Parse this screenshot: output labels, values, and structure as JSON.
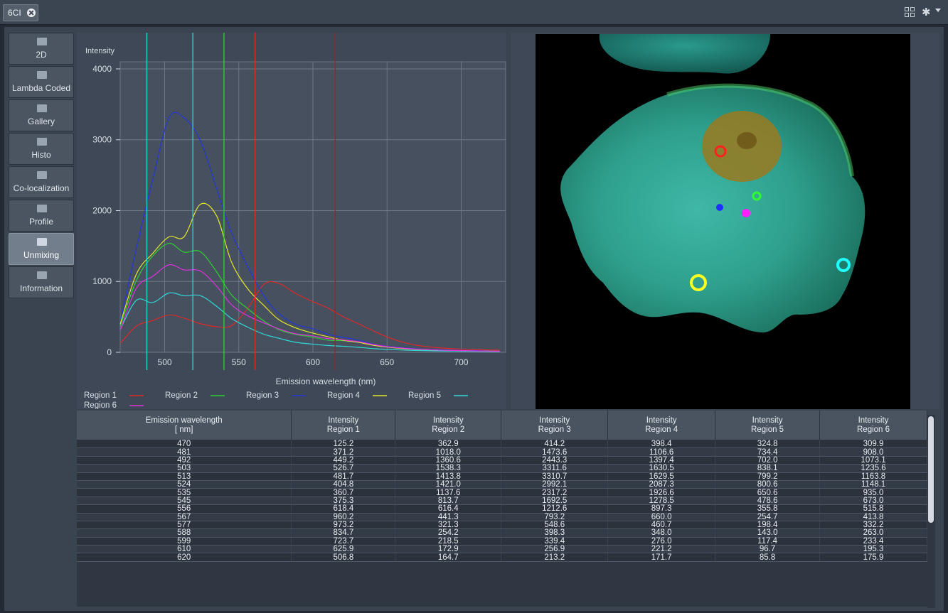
{
  "window": {
    "tab_label": "6CI"
  },
  "view_tabs": [
    {
      "label": "2D",
      "icon": "monitor-icon"
    },
    {
      "label": "Lambda Coded",
      "icon": "lambda-icon"
    },
    {
      "label": "Gallery",
      "icon": "gallery-grid-icon"
    },
    {
      "label": "Histo",
      "icon": "histogram-icon"
    },
    {
      "label": "Co-localization",
      "icon": "colocalization-icon"
    },
    {
      "label": "Profile",
      "icon": "profile-icon"
    },
    {
      "label": "Unmixing",
      "icon": "unmixing-icon",
      "active": true
    },
    {
      "label": "Information",
      "icon": "info-icon"
    }
  ],
  "chart_data": {
    "type": "line",
    "ylabel": "Intensity",
    "xlabel": "Emission wavelength (nm)",
    "xlim": [
      470,
      730
    ],
    "ylim": [
      0,
      4100
    ],
    "xticks": [
      500,
      550,
      600,
      650,
      700
    ],
    "yticks": [
      0,
      1000,
      2000,
      3000,
      4000
    ],
    "grid": true,
    "legend_position": "bottom",
    "x": [
      470,
      481,
      492,
      503,
      513,
      524,
      535,
      545,
      556,
      567,
      577,
      588,
      599,
      610,
      620,
      631,
      642,
      652,
      663,
      673,
      684,
      695,
      705,
      716,
      726
    ],
    "series": [
      {
        "name": "Region 1",
        "color": "#e02828",
        "values": [
          125.2,
          371.2,
          449.2,
          526.7,
          481.7,
          404.8,
          360.7,
          375.3,
          618.4,
          960.2,
          973.2,
          834.7,
          723.7,
          625.9,
          506.8,
          400,
          290,
          200,
          130,
          90,
          65,
          50,
          40,
          35,
          30
        ]
      },
      {
        "name": "Region 2",
        "color": "#2fd12f",
        "values": [
          362.9,
          1018.0,
          1360.6,
          1538.3,
          1413.8,
          1421.0,
          1137.6,
          813.7,
          616.4,
          441.3,
          321.3,
          254.2,
          218.5,
          172.9,
          164.7,
          140,
          100,
          70,
          50,
          40,
          30,
          25,
          20,
          18,
          15
        ]
      },
      {
        "name": "Region 3",
        "color": "#2436d6",
        "values": [
          414.2,
          1473.6,
          2443.3,
          3311.6,
          3310.7,
          2992.1,
          2317.2,
          1692.5,
          1212.6,
          793.2,
          548.6,
          398.3,
          339.4,
          256.9,
          213.2,
          170,
          110,
          80,
          60,
          45,
          35,
          30,
          25,
          20,
          18
        ]
      },
      {
        "name": "Region 4",
        "color": "#e6e62a",
        "values": [
          398.4,
          1106.6,
          1397.4,
          1630.5,
          1629.5,
          2087.3,
          1926.6,
          1278.5,
          897.3,
          660.0,
          460.7,
          348.0,
          276.0,
          221.2,
          171.7,
          140,
          95,
          70,
          50,
          40,
          30,
          25,
          20,
          18,
          15
        ]
      },
      {
        "name": "Region 5",
        "color": "#2fd8d8",
        "values": [
          324.8,
          734.4,
          702.0,
          838.1,
          799.2,
          800.6,
          650.6,
          478.6,
          355.8,
          254.7,
          198.4,
          143.0,
          117.4,
          96.7,
          85.8,
          70,
          50,
          40,
          30,
          25,
          20,
          18,
          15,
          12,
          10
        ]
      },
      {
        "name": "Region 6",
        "color": "#e030e0",
        "values": [
          309.9,
          908.0,
          1073.1,
          1235.6,
          1163.8,
          1148.1,
          935.0,
          673.0,
          515.8,
          413.8,
          332.2,
          263.0,
          233.4,
          195.3,
          175.9,
          150,
          105,
          75,
          55,
          42,
          32,
          26,
          22,
          18,
          15
        ]
      }
    ],
    "markers": [
      {
        "x": 488,
        "color": "#2fd8d8"
      },
      {
        "x": 519,
        "color": "#2fd8d8"
      },
      {
        "x": 540,
        "color": "#2fd12f"
      },
      {
        "x": 561,
        "color": "#e02828"
      },
      {
        "x": 615,
        "color": "#b01c1c"
      }
    ]
  },
  "image_rois": [
    {
      "label": "Region 1",
      "color": "#ff2020"
    },
    {
      "label": "Region 2",
      "color": "#30ff30"
    },
    {
      "label": "Region 3",
      "color": "#2030ff"
    },
    {
      "label": "Region 4",
      "color": "#ffff20"
    },
    {
      "label": "Region 5",
      "color": "#20ffff"
    },
    {
      "label": "Region 6",
      "color": "#ff20ff"
    }
  ],
  "table": {
    "headers": [
      [
        "Emission wavelength",
        "[ nm]"
      ],
      [
        "Intensity",
        "Region 1"
      ],
      [
        "Intensity",
        "Region 2"
      ],
      [
        "Intensity",
        "Region 3"
      ],
      [
        "Intensity",
        "Region 4"
      ],
      [
        "Intensity",
        "Region 5"
      ],
      [
        "Intensity",
        "Region 6"
      ]
    ],
    "rows": [
      [
        "470",
        "125.2",
        "362.9",
        "414.2",
        "398.4",
        "324.8",
        "309.9"
      ],
      [
        "481",
        "371.2",
        "1018.0",
        "1473.6",
        "1106.6",
        "734.4",
        "908.0"
      ],
      [
        "492",
        "449.2",
        "1360.6",
        "2443.3",
        "1397.4",
        "702.0",
        "1073.1"
      ],
      [
        "503",
        "526.7",
        "1538.3",
        "3311.6",
        "1630.5",
        "838.1",
        "1235.6"
      ],
      [
        "513",
        "481.7",
        "1413.8",
        "3310.7",
        "1629.5",
        "799.2",
        "1163.8"
      ],
      [
        "524",
        "404.8",
        "1421.0",
        "2992.1",
        "2087.3",
        "800.6",
        "1148.1"
      ],
      [
        "535",
        "360.7",
        "1137.6",
        "2317.2",
        "1926.6",
        "650.6",
        "935.0"
      ],
      [
        "545",
        "375.3",
        "813.7",
        "1692.5",
        "1278.5",
        "478.6",
        "673.0"
      ],
      [
        "556",
        "618.4",
        "616.4",
        "1212.6",
        "897.3",
        "355.8",
        "515.8"
      ],
      [
        "567",
        "960.2",
        "441.3",
        "793.2",
        "660.0",
        "254.7",
        "413.8"
      ],
      [
        "577",
        "973.2",
        "321.3",
        "548.6",
        "460.7",
        "198.4",
        "332.2"
      ],
      [
        "588",
        "834.7",
        "254.2",
        "398.3",
        "348.0",
        "143.0",
        "263.0"
      ],
      [
        "599",
        "723.7",
        "218.5",
        "339.4",
        "276.0",
        "117.4",
        "233.4"
      ],
      [
        "610",
        "625.9",
        "172.9",
        "256.9",
        "221.2",
        "96.7",
        "195.3"
      ],
      [
        "620",
        "506.8",
        "164.7",
        "213.2",
        "171.7",
        "85.8",
        "175.9"
      ]
    ]
  }
}
